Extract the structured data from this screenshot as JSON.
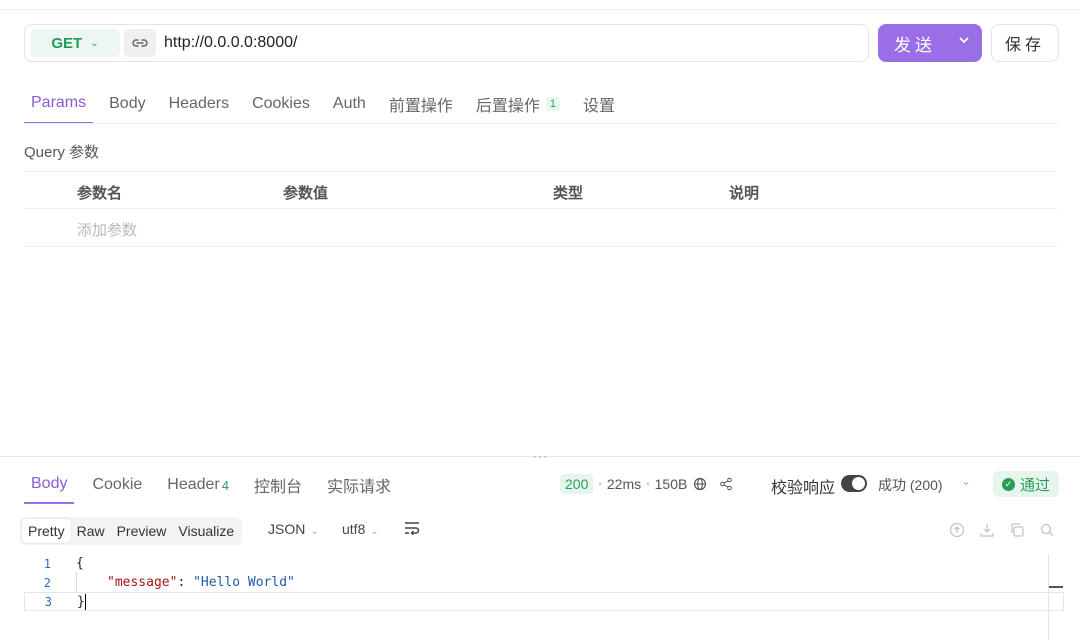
{
  "request": {
    "method": "GET",
    "url": "http://0.0.0.0:8000/",
    "send_label": "发送",
    "save_label": "保存"
  },
  "request_tabs": [
    {
      "label": "Params",
      "active": true
    },
    {
      "label": "Body"
    },
    {
      "label": "Headers"
    },
    {
      "label": "Cookies"
    },
    {
      "label": "Auth"
    },
    {
      "label": "前置操作"
    },
    {
      "label": "后置操作",
      "badge": "1"
    },
    {
      "label": "设置"
    }
  ],
  "query": {
    "title": "Query 参数",
    "columns": [
      "参数名",
      "参数值",
      "类型",
      "说明"
    ],
    "add_placeholder": "添加参数"
  },
  "response_tabs": [
    {
      "label": "Body",
      "active": true
    },
    {
      "label": "Cookie"
    },
    {
      "label": "Header",
      "badge": "4"
    },
    {
      "label": "控制台"
    },
    {
      "label": "实际请求"
    }
  ],
  "response_status": {
    "code": "200",
    "time": "22ms",
    "size": "150B",
    "validate_label": "校验响应",
    "validate_on": true,
    "result": "成功 (200)",
    "pass_label": "通过"
  },
  "format_tabs": [
    "Pretty",
    "Raw",
    "Preview",
    "Visualize"
  ],
  "format_type": "JSON",
  "encoding": "utf8",
  "code_lines": [
    {
      "num": "1",
      "text": "{"
    },
    {
      "num": "2",
      "key": "\"message\"",
      "colon": ": ",
      "value": "\"Hello World\""
    },
    {
      "num": "3",
      "text": "}"
    }
  ],
  "colors": {
    "accent": "#9a6ee6",
    "success": "#2a9d5b"
  }
}
